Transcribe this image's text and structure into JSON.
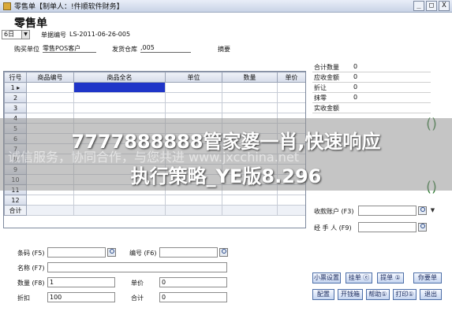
{
  "window": {
    "title": "零售单【制单人：!件顺软件财务】",
    "controls": [
      "_",
      "□",
      "X"
    ]
  },
  "page": {
    "heading": "零售单"
  },
  "header": {
    "date_value": "6日",
    "doc_no_label": "单据编号",
    "doc_no_value": "LS-2011-06-26-005",
    "buyer_label": "购买单位",
    "buyer_value": "零售POS客户",
    "warehouse_label": "发货仓库",
    "warehouse_value": ",005",
    "summary_label": "摘要"
  },
  "grid": {
    "columns": [
      "行号",
      "商品编号",
      "商品全名",
      "单位",
      "数量",
      "单价"
    ],
    "rows": [
      "1",
      "2",
      "3",
      "4",
      "5",
      "6",
      "7",
      "8",
      "9",
      "10",
      "11",
      "12"
    ],
    "total_label": "合计"
  },
  "summary": [
    {
      "label": "合计数量",
      "value": "0"
    },
    {
      "label": "应收金额",
      "value": "0"
    },
    {
      "label": "折让",
      "value": "0"
    },
    {
      "label": "抹零",
      "value": "0"
    },
    {
      "label": "实收金额",
      "value": ""
    }
  ],
  "payment": {
    "account_label": "收款账户 (F3)",
    "handler_label": "经 手 人 (F9)"
  },
  "entry": {
    "barcode_label": "条码 (F5)",
    "code_label": "编号 (F6)",
    "name_label": "名称 (F7)",
    "qty_label": "数量 (F8)",
    "qty_value": "1",
    "price_label": "单价",
    "price_value": "0",
    "discount_label": "折扣",
    "discount_value": "100",
    "total_label": "合计",
    "total_value": "0"
  },
  "buttons": {
    "row1": [
      "小票设置",
      "挂单 ⓔ",
      "提单 ①",
      "你要单"
    ],
    "row2": [
      "配置",
      "开钱箱",
      "帮助①",
      "打印①",
      "退出"
    ]
  },
  "overlay": {
    "line1": "7777888888管家婆一肖,快速响应",
    "line2": "执行策略_YE版8.296",
    "watermark": "诚信服务，协同合作，与您共进   www.jxcchina.net"
  },
  "colors": {
    "selection": "#1f35c8",
    "titlebar": "#c8d3e6",
    "button_border": "#4d6ea7"
  }
}
